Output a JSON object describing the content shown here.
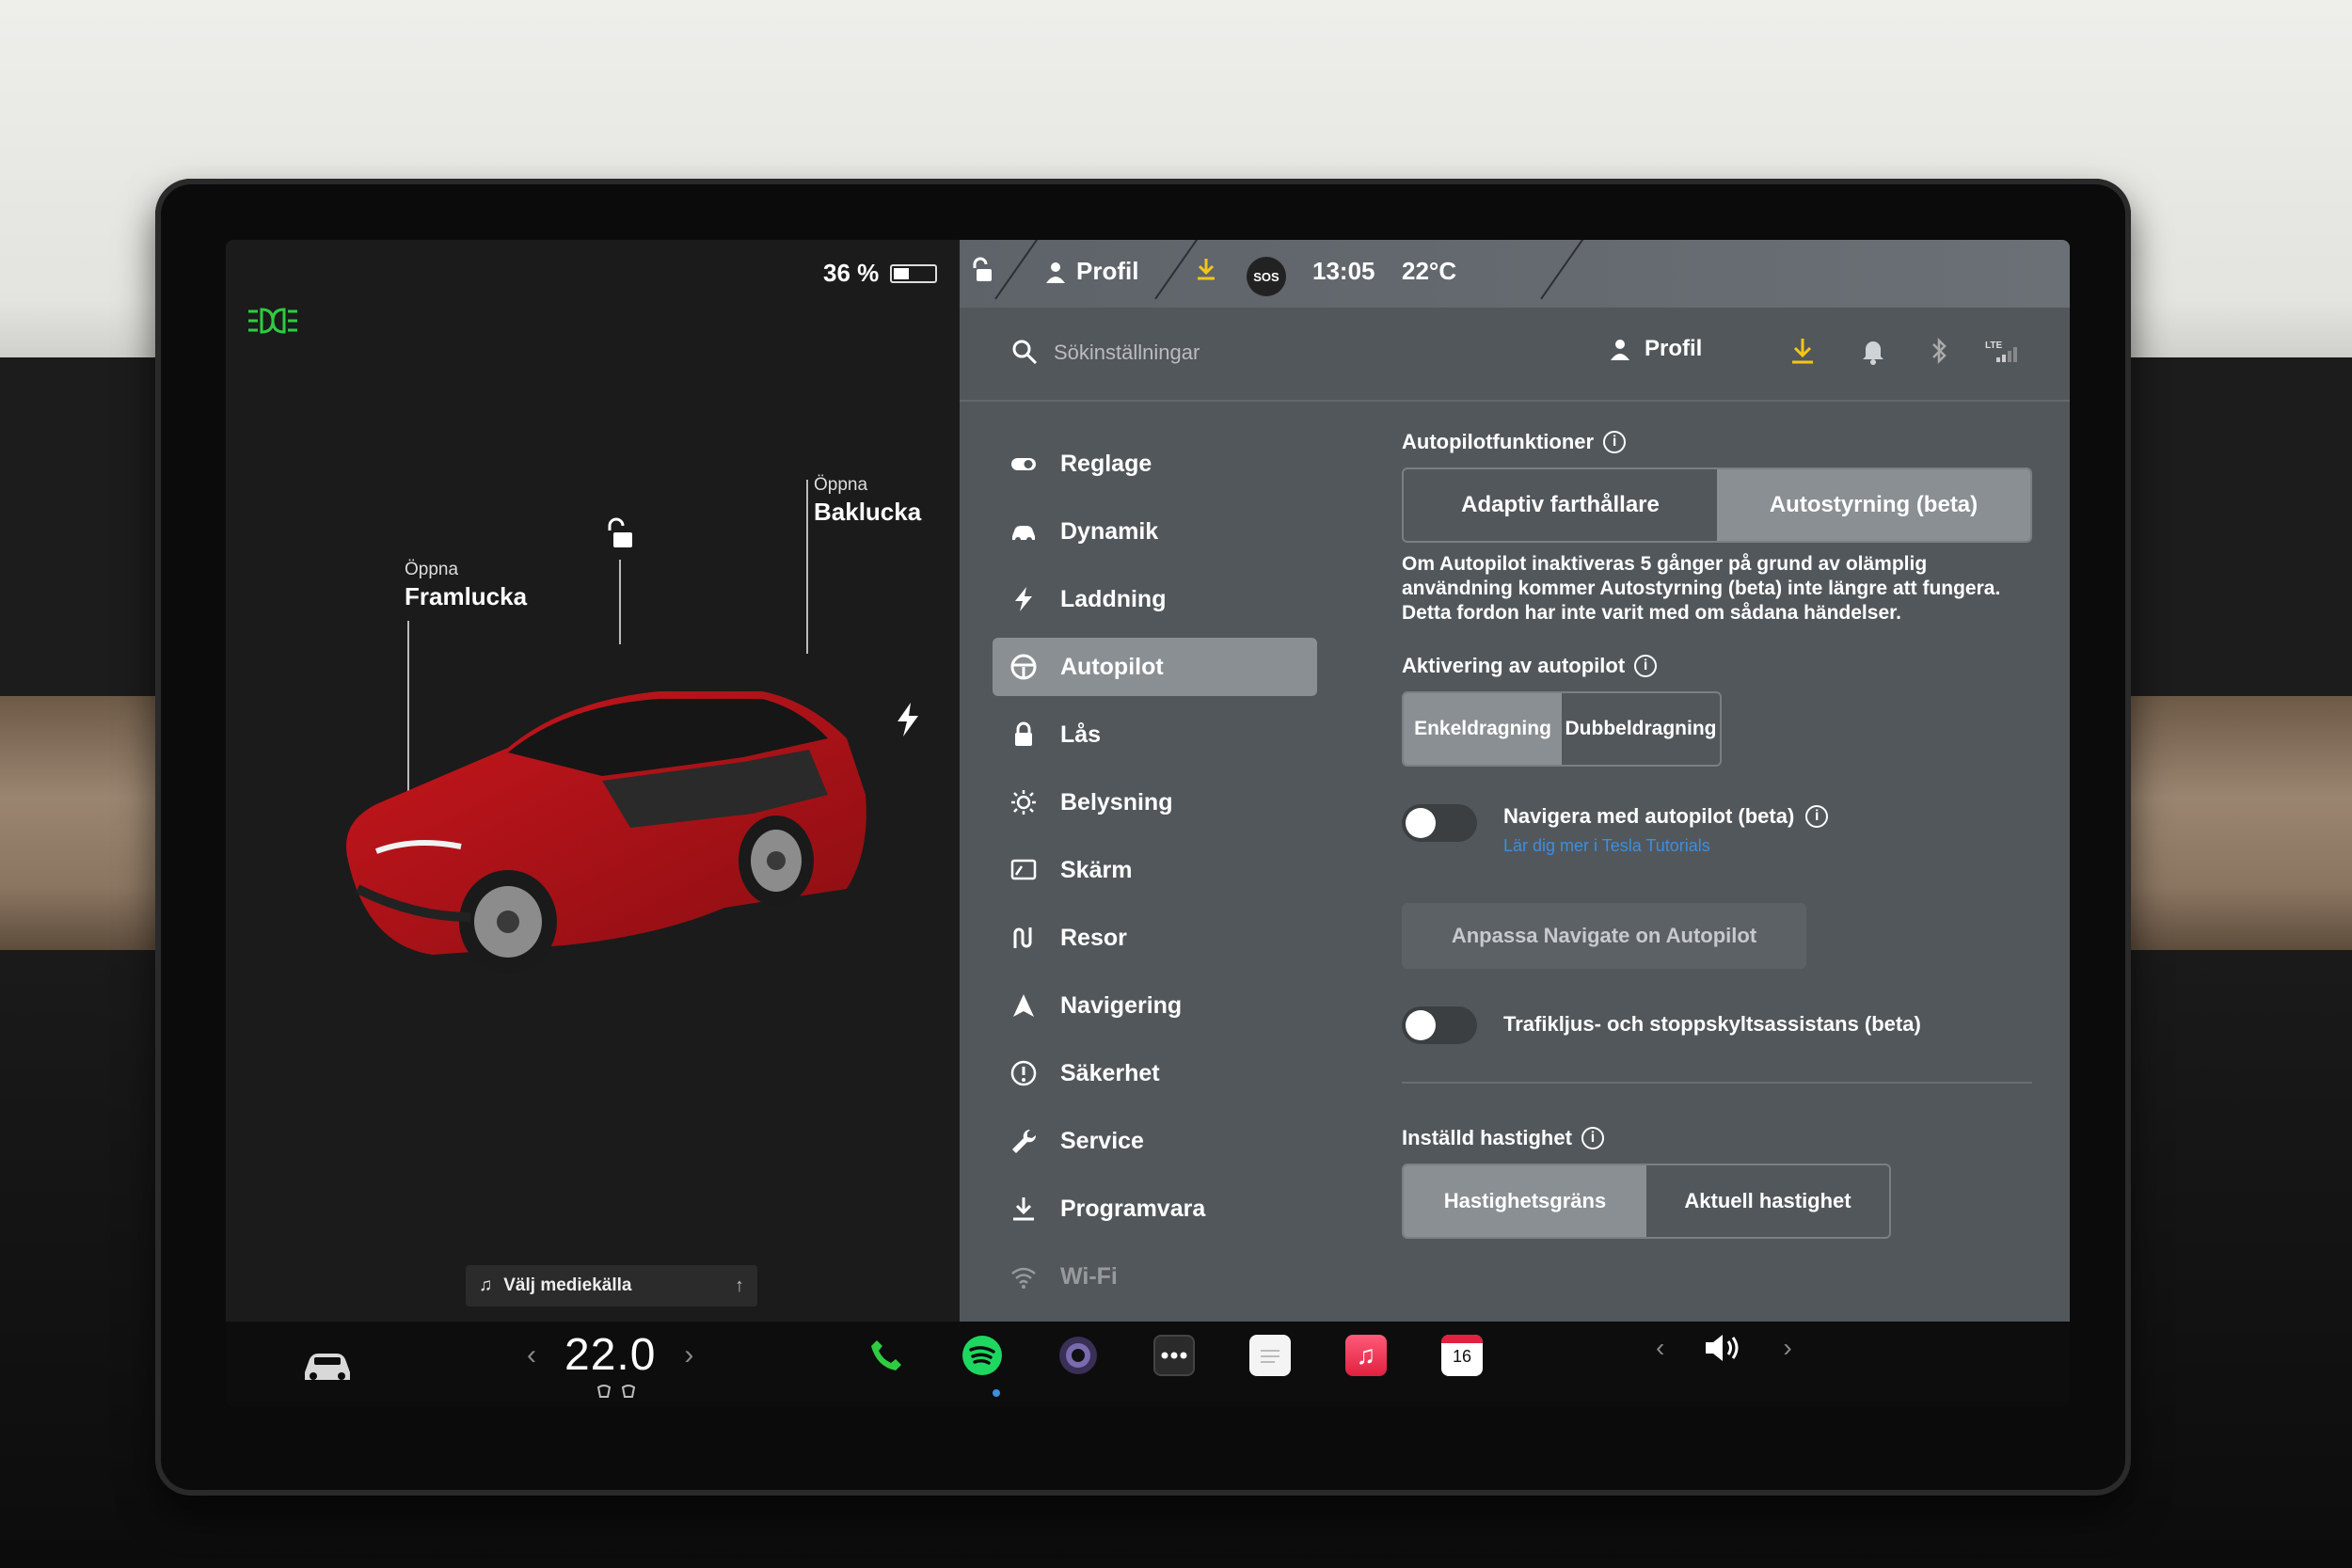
{
  "status": {
    "battery_percent": "36 %",
    "battery_level": 0.36
  },
  "car": {
    "front_label_small": "Öppna",
    "front_label_big": "Framlucka",
    "rear_label_small": "Öppna",
    "rear_label_big": "Baklucka",
    "body_color": "#c8161d"
  },
  "mapstrip": {
    "profile": "Profil",
    "sos": "SOS",
    "time": "13:05",
    "outside_temp": "22°C"
  },
  "search": {
    "placeholder": "Sökinställningar"
  },
  "header": {
    "profile_label": "Profil",
    "lte": "LTE",
    "download_color": "#f5c518"
  },
  "nav": {
    "items": [
      {
        "label": "Reglage",
        "icon": "toggle-icon"
      },
      {
        "label": "Dynamik",
        "icon": "car-icon"
      },
      {
        "label": "Laddning",
        "icon": "bolt-icon"
      },
      {
        "label": "Autopilot",
        "icon": "steering-wheel-icon",
        "active": true
      },
      {
        "label": "Lås",
        "icon": "lock-icon"
      },
      {
        "label": "Belysning",
        "icon": "sun-icon"
      },
      {
        "label": "Skärm",
        "icon": "display-icon"
      },
      {
        "label": "Resor",
        "icon": "trips-icon"
      },
      {
        "label": "Navigering",
        "icon": "navigation-arrow-icon"
      },
      {
        "label": "Säkerhet",
        "icon": "safety-icon"
      },
      {
        "label": "Service",
        "icon": "wrench-icon"
      },
      {
        "label": "Programvara",
        "icon": "download-icon"
      },
      {
        "label": "Wi-Fi",
        "icon": "wifi-icon"
      }
    ]
  },
  "autopilot": {
    "features_title": "Autopilotfunktioner",
    "features_options": [
      "Adaptiv farthållare",
      "Autostyrning (beta)"
    ],
    "features_selected": "Autostyrning (beta)",
    "warning": "Om Autopilot inaktiveras 5 gånger på grund av olämplig användning kommer Autostyrning (beta) inte längre att fungera. Detta fordon har inte varit med om sådana händelser.",
    "activation_title": "Aktivering av autopilot",
    "activation_options": [
      "Enkeldragning",
      "Dubbeldragning"
    ],
    "activation_selected": "Enkeldragning",
    "nav_autopilot_label": "Navigera med autopilot (beta)",
    "nav_autopilot_link": "Lär dig mer i Tesla Tutorials",
    "nav_autopilot_on": false,
    "customize_button": "Anpassa Navigate on Autopilot",
    "traffic_label": "Trafikljus- och stoppskyltsassistans (beta)",
    "traffic_on": false,
    "speed_title": "Inställd hastighet",
    "speed_options": [
      "Hastighetsgräns",
      "Aktuell hastighet"
    ],
    "speed_selected": "Hastighetsgräns"
  },
  "media": {
    "label": "Välj mediekälla"
  },
  "bottombar": {
    "cabin_temp": "22.0",
    "calendar_day": "16",
    "apps": [
      "phone-icon",
      "spotify-icon",
      "camera-icon",
      "more-icon",
      "notes-icon",
      "music-icon",
      "calendar-icon"
    ]
  }
}
